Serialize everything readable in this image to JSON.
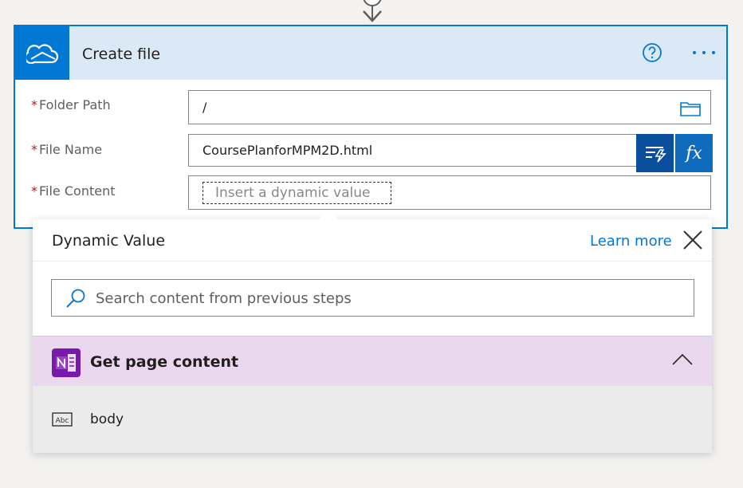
{
  "card": {
    "title": "Create file",
    "icon": "onedrive-cloud-icon",
    "accent": "#0078d4"
  },
  "fields": {
    "folder_path": {
      "label": "Folder Path",
      "value": "/"
    },
    "file_name": {
      "label": "File Name",
      "value": "CoursePlanforMPM2D.html"
    },
    "file_content": {
      "label": "File Content",
      "placeholder": "Insert a dynamic value"
    },
    "required_mark": "*"
  },
  "dynamic_buttons": {
    "dynamic": "dynamic-content-icon",
    "expression": "fx"
  },
  "popup": {
    "title": "Dynamic Value",
    "learn_more": "Learn more",
    "search_placeholder": "Search content from previous steps",
    "section": {
      "title": "Get page content",
      "icon": "onenote-icon",
      "color": "#ead9ee"
    },
    "items": [
      {
        "label": "body",
        "icon": "abc-text-icon"
      }
    ]
  }
}
